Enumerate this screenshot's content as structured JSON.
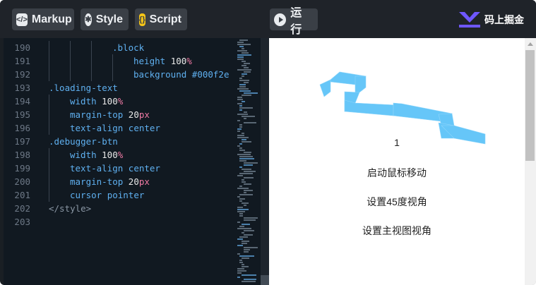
{
  "toolbar": {
    "markup_label": "Markup",
    "style_label": "Style",
    "script_label": "Script",
    "run_label": "运行",
    "brand_label": "码上掘金"
  },
  "editor": {
    "lines": [
      {
        "num": "190",
        "indent": 3,
        "tokens": [
          {
            "t": ".block",
            "c": "t-sel"
          }
        ]
      },
      {
        "num": "191",
        "indent": 4,
        "tokens": [
          {
            "t": "height ",
            "c": "t-prop"
          },
          {
            "t": "100",
            "c": "t-num"
          },
          {
            "t": "%",
            "c": "t-unit"
          }
        ]
      },
      {
        "num": "192",
        "indent": 4,
        "tokens": [
          {
            "t": "background ",
            "c": "t-prop"
          },
          {
            "t": "#000f2e",
            "c": "t-kw"
          }
        ]
      },
      {
        "num": "193",
        "indent": 0,
        "tokens": [
          {
            "t": ".loading-text",
            "c": "t-sel"
          }
        ]
      },
      {
        "num": "194",
        "indent": 1,
        "tokens": [
          {
            "t": "width ",
            "c": "t-prop"
          },
          {
            "t": "100",
            "c": "t-num"
          },
          {
            "t": "%",
            "c": "t-unit"
          }
        ]
      },
      {
        "num": "195",
        "indent": 1,
        "tokens": [
          {
            "t": "margin-top ",
            "c": "t-prop"
          },
          {
            "t": "20",
            "c": "t-num"
          },
          {
            "t": "px",
            "c": "t-unit"
          }
        ]
      },
      {
        "num": "196",
        "indent": 1,
        "tokens": [
          {
            "t": "text-align ",
            "c": "t-prop"
          },
          {
            "t": "center",
            "c": "t-kw"
          }
        ]
      },
      {
        "num": "197",
        "indent": 0,
        "tokens": [
          {
            "t": ".debugger-btn",
            "c": "t-sel"
          }
        ]
      },
      {
        "num": "198",
        "indent": 1,
        "tokens": [
          {
            "t": "width ",
            "c": "t-prop"
          },
          {
            "t": "100",
            "c": "t-num"
          },
          {
            "t": "%",
            "c": "t-unit"
          }
        ]
      },
      {
        "num": "199",
        "indent": 1,
        "tokens": [
          {
            "t": "text-align ",
            "c": "t-prop"
          },
          {
            "t": "center",
            "c": "t-kw"
          }
        ]
      },
      {
        "num": "200",
        "indent": 1,
        "tokens": [
          {
            "t": "margin-top ",
            "c": "t-prop"
          },
          {
            "t": "20",
            "c": "t-num"
          },
          {
            "t": "px",
            "c": "t-unit"
          }
        ]
      },
      {
        "num": "201",
        "indent": 1,
        "tokens": [
          {
            "t": "cursor ",
            "c": "t-prop"
          },
          {
            "t": "pointer",
            "c": "t-kw"
          }
        ]
      },
      {
        "num": "202",
        "indent": 0,
        "tokens": [
          {
            "t": "</style>",
            "c": "t-tag"
          }
        ]
      },
      {
        "num": "203",
        "indent": 0,
        "tokens": []
      }
    ]
  },
  "preview": {
    "loading_text": "1",
    "btn_mouse_move": "启动鼠标移动",
    "btn_45_view": "设置45度视角",
    "btn_main_view": "设置主视图视角",
    "block_color": "#66c6f8"
  }
}
